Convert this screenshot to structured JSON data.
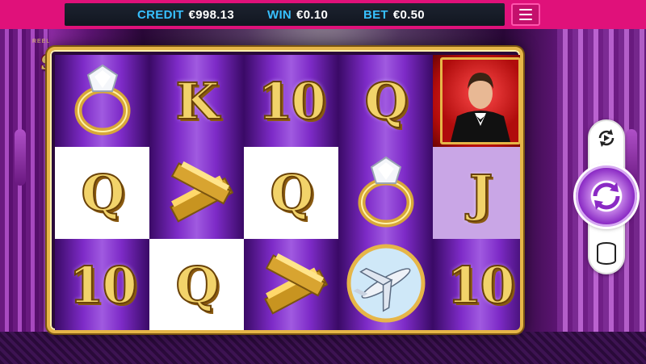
{
  "header": {
    "credit_label": "CREDIT",
    "credit_value": "€998.13",
    "win_label": "WIN",
    "win_value": "€0.10",
    "bet_label": "BET",
    "bet_value": "€0.50",
    "menu_icon": "hamburger-menu-icon"
  },
  "logo": {
    "small_text": "REEL",
    "title": "Splendour"
  },
  "reels": [
    [
      {
        "symbol": "diamond-ring",
        "bg": "purple"
      },
      {
        "symbol": "Q",
        "bg": "white"
      },
      {
        "symbol": "10",
        "bg": "purple"
      }
    ],
    [
      {
        "symbol": "K",
        "bg": "purple"
      },
      {
        "symbol": "gold-bars",
        "bg": "purple"
      },
      {
        "symbol": "Q",
        "bg": "white"
      }
    ],
    [
      {
        "symbol": "10",
        "bg": "purple"
      },
      {
        "symbol": "Q",
        "bg": "white"
      },
      {
        "symbol": "gold-bars",
        "bg": "purple"
      }
    ],
    [
      {
        "symbol": "Q",
        "bg": "purple"
      },
      {
        "symbol": "diamond-ring",
        "bg": "purple"
      },
      {
        "symbol": "private-jet",
        "bg": "purple"
      }
    ],
    [
      {
        "symbol": "gentleman-portrait",
        "bg": "red"
      },
      {
        "symbol": "J",
        "bg": "lilac"
      },
      {
        "symbol": "10",
        "bg": "purple"
      }
    ]
  ],
  "controls": {
    "autoplay_icon": "autoplay-icon",
    "spin_icon": "spin-arrows-icon",
    "stake_icon": "coin-stack-icon"
  },
  "colors": {
    "topbar": "#e0117a",
    "label": "#37c0ff",
    "value": "#ffffff",
    "gold": "#e6b648",
    "spin": "#8a2ac4"
  }
}
